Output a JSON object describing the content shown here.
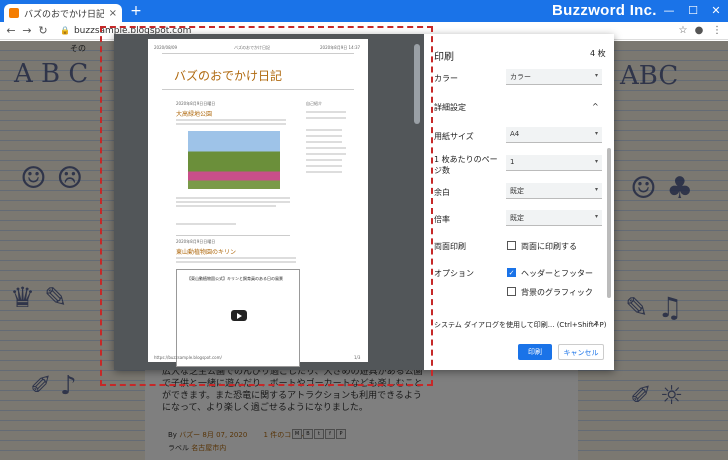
{
  "browser": {
    "tab_title": "バズのおでかけ日記",
    "tab_close": "×",
    "new_tab": "+",
    "url": "buzzsample.blogspot.com",
    "brand": "Buzzword Inc.",
    "controls": {
      "minimize": "—",
      "maximize": "☐",
      "close": "✕"
    },
    "nav": {
      "back": "←",
      "forward": "→",
      "reload": "↻"
    },
    "toolbar_icons": {
      "star": "☆",
      "profile": "●",
      "menu": "⋮"
    }
  },
  "page_bg_partial": "その",
  "preview": {
    "header_left": "2020/08/09",
    "header_center": "バズのおでかけ日記",
    "header_right": "2020年8月9日 14:37",
    "blog_title": "バズのおでかけ日記",
    "post_date": "2020年8月9日日曜日",
    "post1_title": "大高緑地公園",
    "post2_title": "東山動植物園のキリン",
    "video_title": "【東山動植物園公式】キリンと飼育員のある日の風景",
    "sidebar_head": "自己紹介",
    "footer_url": "https://buzzsample.blogspot.com/",
    "page_num": "1/3"
  },
  "print": {
    "title": "印刷",
    "sheets": "4 枚",
    "color_label": "カラー",
    "color_value": "カラー",
    "details_label": "詳細設定",
    "paper_label": "用紙サイズ",
    "paper_value": "A4",
    "pages_per_sheet_label": "1 枚あたりのページ数",
    "pages_per_sheet_value": "1",
    "margins_label": "余白",
    "margins_value": "既定",
    "scale_label": "倍率",
    "scale_value": "既定",
    "duplex_label": "両面印刷",
    "duplex_option": "両面に印刷する",
    "options_label": "オプション",
    "headers_option": "ヘッダーとフッター",
    "bg_option": "背景のグラフィック",
    "system_dialog": "システム ダイアログを使用して印刷... (Ctrl+Shift+P)",
    "print_button": "印刷",
    "cancel_button": "キャンセル",
    "chevron": "▾",
    "collapse": "^"
  },
  "post_below": {
    "text": "広大な芝生公園でのんびり過ごしたり、大きめの遊具がある公園で子供と一緒に遊んだり、ボートやゴーカートなども楽しむことができます。また恐竜に関するアトラクションも利用できるようになって、より楽しく過ごせるようになりました。",
    "by": "By",
    "author": "バズー",
    "date": "8月 07, 2020",
    "comments": "1 件のコメント",
    "labels_prefix": "ラベル",
    "labels": "名古屋市内"
  }
}
